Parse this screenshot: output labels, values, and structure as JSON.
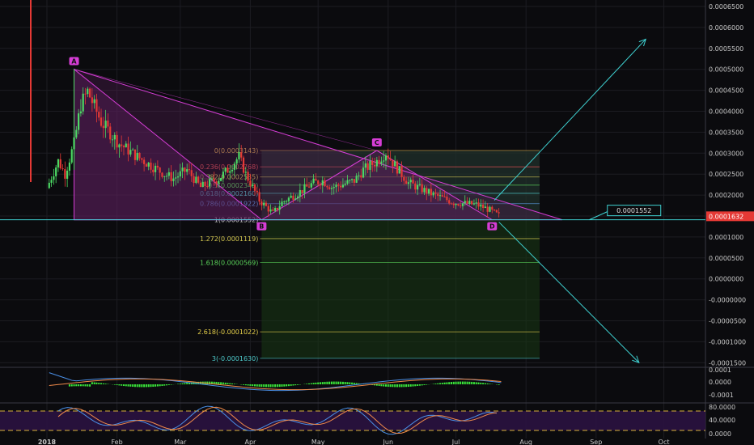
{
  "colors": {
    "background": "#0b0b0e",
    "up_candle": "#4cd964",
    "down_candle": "#e53935",
    "pattern": "#d63dd6",
    "pattern_fill": "#5a1f5a",
    "trendline": "#3fd2d2",
    "axis_text": "#c8c8c8",
    "price_tag": "#e53935",
    "macd_hist": "#39e639",
    "macd_line": "#4a8fe6",
    "signal_line": "#f08a4a",
    "stoch_k": "#4a8fe6",
    "stoch_d": "#f08a4a",
    "stoch_band": "#2a1240",
    "stoch_dash": "#d9b23a"
  },
  "chart_data": [
    {
      "type": "candlestick",
      "x_axis": {
        "ticks": [
          "2018",
          "Feb",
          "Mar",
          "Apr",
          "May",
          "Jun",
          "Jul",
          "Aug",
          "Sep",
          "Oct"
        ]
      },
      "y_axis": {
        "scale": "linear",
        "range": [
          -0.00018,
          0.00066
        ],
        "ticks": [
          "0.0006500",
          "0.0006000",
          "0.0005500",
          "0.0005000",
          "0.0004500",
          "0.0004000",
          "0.0003500",
          "0.0003000",
          "0.0002500",
          "0.0002000",
          "0.0001500",
          "0.0001000",
          "0.0000500",
          "0.0000000",
          "-0.0000000",
          "-0.0000500",
          "-0.0001000",
          "-0.0001500"
        ]
      },
      "price_tag": "0.0001632",
      "support_tag": "0.0001552",
      "support_level": 0.0001552,
      "series": {
        "close": [
          0.000228,
          0.00029,
          0.00026,
          0.00033,
          0.00042,
          0.00045,
          0.00038,
          0.00033,
          0.0003,
          0.00028,
          0.00026,
          0.00025,
          0.00027,
          0.00023,
          0.00024,
          0.00025,
          0.00027,
          0.0003,
          0.00026,
          0.0002,
          0.00017,
          0.000195,
          0.00022,
          0.00024,
          0.000245,
          0.00023,
          0.000235,
          0.000245,
          0.00027,
          0.00029,
          0.00031,
          0.00028,
          0.00024,
          0.000225,
          0.000215,
          0.000205,
          0.000195,
          0.000192,
          0.00019,
          0.00018,
          0.000165
        ],
        "anchor_days": [
          0,
          5,
          8,
          12,
          15,
          18,
          24,
          32,
          40,
          46,
          52,
          56,
          62,
          68,
          72,
          76,
          80,
          85,
          88,
          94,
          100,
          104,
          112,
          118,
          122,
          126,
          130,
          136,
          140,
          146,
          150,
          154,
          160,
          166,
          170,
          175,
          180,
          186,
          190,
          195,
          200
        ],
        "start_label": "2018",
        "candle_count": 200
      },
      "pattern": {
        "name": "ABCD",
        "points": [
          {
            "label": "A",
            "day": 12,
            "price": 0.000501
          },
          {
            "label": "B",
            "day": 95,
            "price": 0.0001552
          },
          {
            "label": "C",
            "day": 146,
            "price": 0.0003143
          },
          {
            "label": "D",
            "day": 197,
            "price": 0.0001552
          }
        ]
      },
      "fib_levels": [
        {
          "label": "0(0.0003143)",
          "value": 0.0003143,
          "color": "#d4a84a"
        },
        {
          "label": "0.236(0.0002768)",
          "value": 0.0002768,
          "color": "#e05050"
        },
        {
          "label": "0.382(0.0002535)",
          "value": 0.0002535,
          "color": "#d4c850"
        },
        {
          "label": "0.5(0.0002348)",
          "value": 0.0002348,
          "color": "#5ad35a"
        },
        {
          "label": "0.618(0.0002160)",
          "value": 0.000216,
          "color": "#4ec9c9"
        },
        {
          "label": "0.786(0.0001922)",
          "value": 0.0001922,
          "color": "#5aa0e6"
        },
        {
          "label": "1(0.0001552)",
          "value": 0.0001552,
          "color": "#c8c8c8"
        },
        {
          "label": "1.272(0.0001119)",
          "value": 0.0001119,
          "color": "#d4c850"
        },
        {
          "label": "1.618(0.0000569)",
          "value": 5.69e-05,
          "color": "#5ad35a"
        },
        {
          "label": "2.618(-0.0001022)",
          "value": -0.0001022,
          "color": "#e6d04a"
        },
        {
          "label": "3(-0.0001630)",
          "value": -0.000163,
          "color": "#4ec9c9"
        }
      ],
      "projections": [
        {
          "from_day": 198,
          "from_price": 0.0002,
          "to_day": 265,
          "to_price": 0.00057
        },
        {
          "from_day": 200,
          "from_price": 0.00015,
          "to_day": 262,
          "to_price": -0.000173
        }
      ]
    },
    {
      "type": "line",
      "name": "MACD",
      "y_axis": {
        "ticks": [
          "0.0001",
          "0.0000",
          "-0.0001"
        ],
        "range": [
          -0.00011,
          0.00011
        ]
      }
    },
    {
      "type": "line",
      "name": "Stochastic",
      "y_axis": {
        "ticks": [
          "80.0000",
          "40.0000",
          "0.0000"
        ],
        "range": [
          -5,
          105
        ]
      },
      "bands": [
        80,
        20
      ]
    }
  ]
}
